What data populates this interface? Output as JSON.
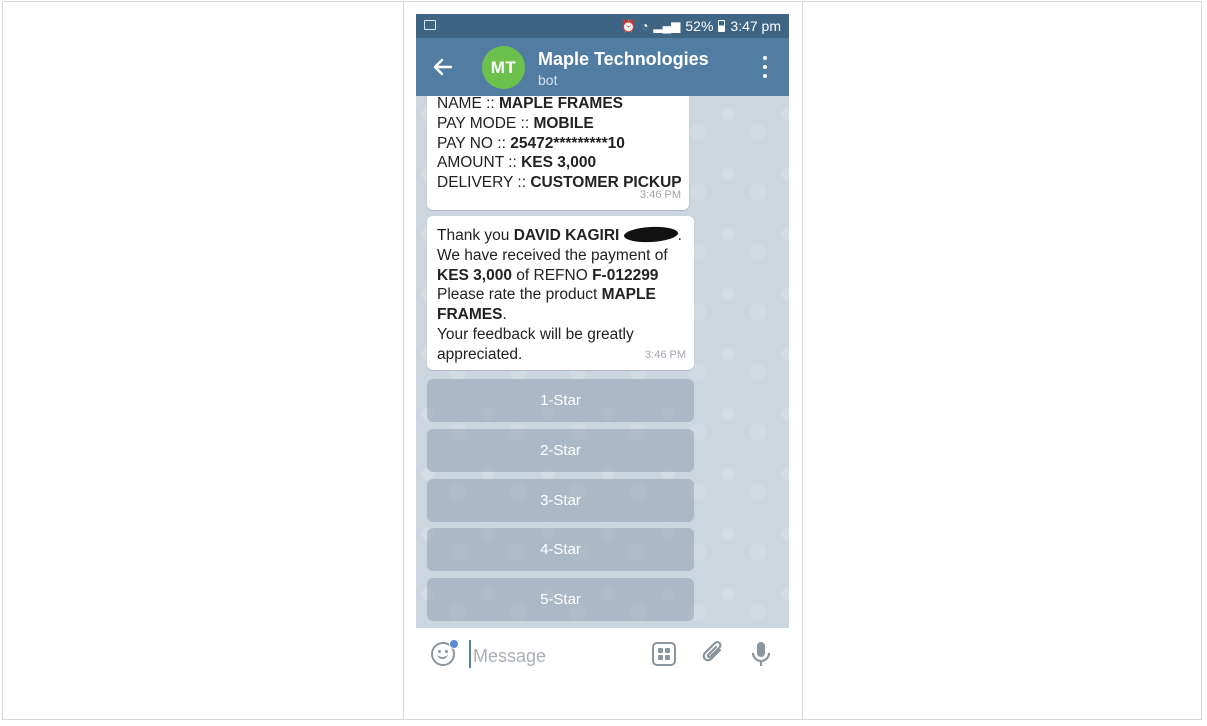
{
  "status_bar": {
    "battery_percent": "52%",
    "time": "3:47 pm"
  },
  "header": {
    "avatar_initials": "MT",
    "title": "Maple Technologies",
    "subtitle": "bot"
  },
  "messages": [
    {
      "lines": [
        {
          "label": "NAME :: ",
          "value": "MAPLE FRAMES"
        },
        {
          "label": "PAY MODE :: ",
          "value": "MOBILE"
        },
        {
          "label": "PAY NO :: ",
          "value": "25472*********10"
        },
        {
          "label": "AMOUNT :: ",
          "value": "KES 3,000"
        },
        {
          "label": "DELIVERY  :: ",
          "value": "CUSTOMER PICKUP"
        }
      ],
      "time": "3:46 PM"
    },
    {
      "thank_prefix": "Thank you ",
      "name": "DAVID KAGIRI",
      "received_line": "We have received the payment of",
      "amount": "KES 3,000",
      "refno_label": " of REFNO ",
      "refno": "F-012299",
      "rate_prefix": "Please rate the product ",
      "product_part1": "MAPLE",
      "product_part2": "FRAMES",
      "feedback_line1": "Your feedback will be greatly",
      "feedback_line2": "appreciated.",
      "time": "3:46 PM"
    }
  ],
  "rating_buttons": [
    "1-Star",
    "2-Star",
    "3-Star",
    "4-Star",
    "5-Star"
  ],
  "input": {
    "placeholder": "Message"
  },
  "icons": [
    "back-arrow-icon",
    "more-vert-icon",
    "emoji-icon",
    "bot-commands-icon",
    "attach-icon",
    "mic-icon"
  ],
  "colors": {
    "header": "#527da3",
    "status_bar": "#3f6585",
    "avatar": "#6cc14d",
    "chat_bg": "#ccd6df"
  }
}
